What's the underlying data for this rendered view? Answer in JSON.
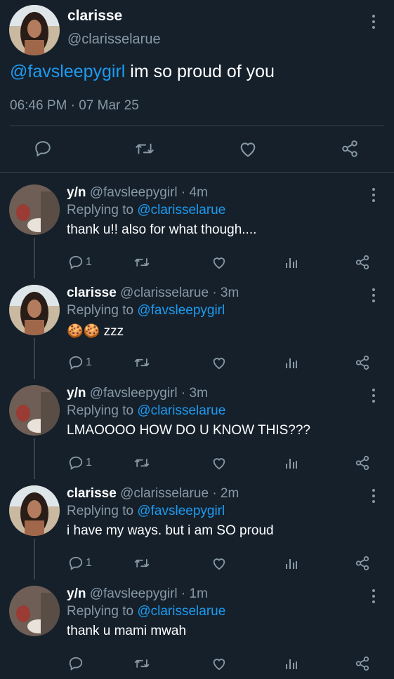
{
  "main_tweet": {
    "name": "clarisse",
    "handle": "@clarisselarue",
    "mention": "@favsleepygirl",
    "text": " im so proud of you",
    "timestamp": "06:46 PM · 07 Mar 25"
  },
  "replies": [
    {
      "name": "y/n",
      "handle": "@favsleepygirl",
      "time": "· 4m",
      "replying_prefix": "Replying to ",
      "replying_to": "@clarisselarue",
      "text": "thank u!! also for what though....",
      "reply_count": "1"
    },
    {
      "name": "clarisse",
      "handle": "@clarisselarue",
      "time": "· 3m",
      "replying_prefix": "Replying to ",
      "replying_to": "@favsleepygirl",
      "text": "🍪🍪 zzz",
      "reply_count": "1"
    },
    {
      "name": "y/n",
      "handle": "@favsleepygirl",
      "time": "· 3m",
      "replying_prefix": "Replying to ",
      "replying_to": "@clarisselarue",
      "text": "LMAOOOO HOW DO U KNOW THIS???",
      "reply_count": "1"
    },
    {
      "name": "clarisse",
      "handle": "@clarisselarue",
      "time": "· 2m",
      "replying_prefix": "Replying to ",
      "replying_to": "@favsleepygirl",
      "text": "i have my ways. but i am SO proud",
      "reply_count": "1"
    },
    {
      "name": "y/n",
      "handle": "@favsleepygirl",
      "time": "· 1m",
      "replying_prefix": "Replying to ",
      "replying_to": "@clarisselarue",
      "text": "thank u mami mwah",
      "reply_count": ""
    }
  ],
  "colors": {
    "background": "#15202b",
    "link": "#1d9bf0",
    "muted": "#8899a6",
    "divider": "#38444d"
  },
  "icons": [
    "reply-icon",
    "retweet-icon",
    "like-icon",
    "share-icon",
    "analytics-icon",
    "more-icon"
  ]
}
